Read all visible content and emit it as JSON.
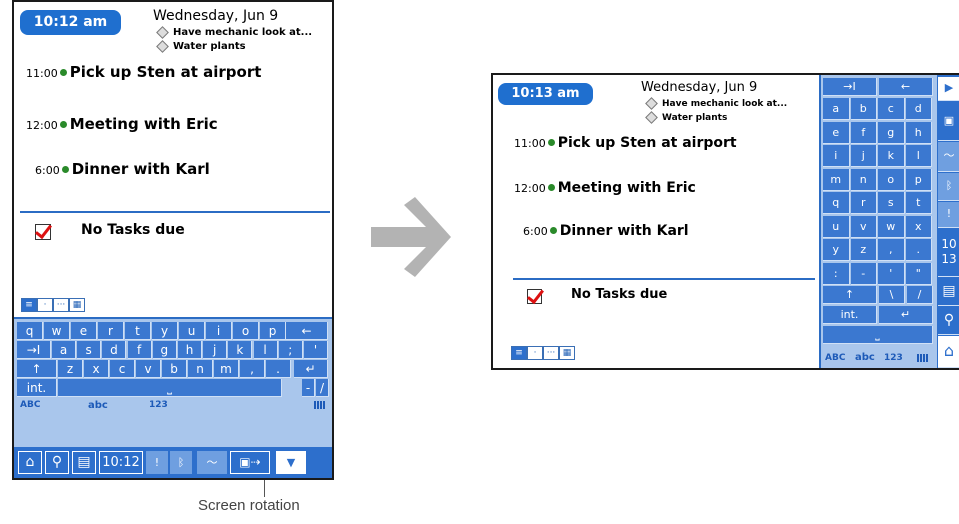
{
  "portrait": {
    "time": "10:12 am",
    "date": "Wednesday, Jun 9",
    "untimed_events": [
      "Have mechanic look at...",
      "Water plants"
    ],
    "appointments": [
      {
        "time": "11:00",
        "title": "Pick up Sten at airport"
      },
      {
        "time": "12:00",
        "title": "Meeting with Eric"
      },
      {
        "time": "6:00",
        "title": "Dinner with Karl"
      }
    ],
    "tasks_text": "No Tasks due",
    "keyboard": {
      "row1": [
        "q",
        "w",
        "e",
        "r",
        "t",
        "y",
        "u",
        "i",
        "o",
        "p"
      ],
      "backspace": "←",
      "tab": "→I",
      "row2": [
        "a",
        "s",
        "d",
        "f",
        "g",
        "h",
        "j",
        "k",
        "l",
        ";",
        "'"
      ],
      "shift": "↑",
      "row3": [
        "z",
        "x",
        "c",
        "v",
        "b",
        "n",
        "m",
        ",",
        "."
      ],
      "enter": "↵",
      "int": "int.",
      "space": "⎵",
      "dash": "-",
      "slash": "/",
      "modes": [
        "ABC",
        "abc",
        "123"
      ]
    },
    "status_bar": {
      "clock": "10:12",
      "icons": [
        "home-icon",
        "find-icon",
        "menu-icon",
        "clock-display",
        "alert-icon",
        "bluetooth-icon",
        "graffiti-icon",
        "screen-rotation-icon",
        "input-area-icon"
      ]
    }
  },
  "landscape": {
    "time": "10:13 am",
    "date": "Wednesday, Jun 9",
    "untimed_events": [
      "Have mechanic look at...",
      "Water plants"
    ],
    "appointments": [
      {
        "time": "11:00",
        "title": "Pick up Sten at airport"
      },
      {
        "time": "12:00",
        "title": "Meeting with Eric"
      },
      {
        "time": "6:00",
        "title": "Dinner with Karl"
      }
    ],
    "tasks_text": "No Tasks due",
    "keyboard": {
      "top": [
        "→I",
        "←"
      ],
      "rows": [
        [
          "a",
          "b",
          "c",
          "d"
        ],
        [
          "e",
          "f",
          "g",
          "h"
        ],
        [
          "i",
          "j",
          "k",
          "l"
        ],
        [
          "m",
          "n",
          "o",
          "p"
        ],
        [
          "q",
          "r",
          "s",
          "t"
        ],
        [
          "u",
          "v",
          "w",
          "x"
        ],
        [
          "y",
          "z",
          ",",
          "."
        ],
        [
          ":",
          "-",
          "'",
          "\""
        ]
      ],
      "shift": "↑",
      "backslash": "\\",
      "slash": "/",
      "int": "int.",
      "enter": "↵",
      "space": "⎵",
      "modes": [
        "ABC",
        "abc",
        "123"
      ]
    },
    "side_clock": [
      "10",
      "13"
    ]
  },
  "caption": "Screen rotation",
  "colors": {
    "accent": "#2d6fcc",
    "key": "#3b78d0",
    "panel": "#a9c6ec",
    "arrow": "#b3b3b3",
    "dot": "#2a8a2a",
    "check": "#dd1111"
  }
}
